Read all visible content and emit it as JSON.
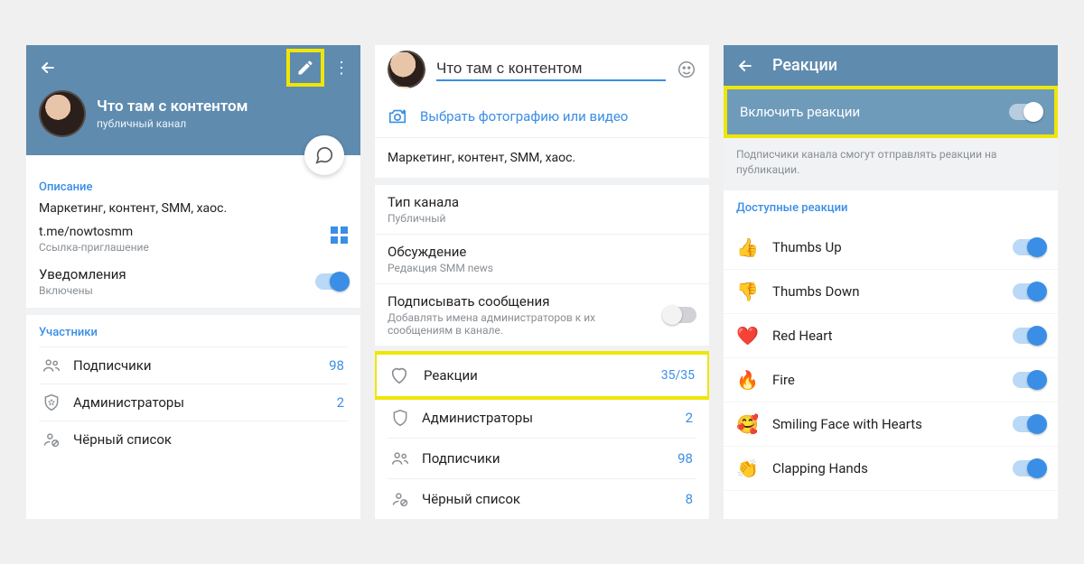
{
  "pane1": {
    "channel_title": "Что там с контентом",
    "channel_subtitle": "публичный канал",
    "section_description_label": "Описание",
    "description": "Маркетинг, контент, SMM, хаос.",
    "invite_link": "t.me/nowtosmm",
    "invite_link_sub": "Ссылка-приглашение",
    "notifications_label": "Уведомления",
    "notifications_value": "Включены",
    "members_label": "Участники",
    "rows": {
      "subscribers": {
        "label": "Подписчики",
        "value": "98"
      },
      "admins": {
        "label": "Администраторы",
        "value": "2"
      },
      "blacklist": {
        "label": "Чёрный список"
      }
    }
  },
  "pane2": {
    "input_value": "Что там с контентом",
    "photo_action": "Выбрать фотографию или видео",
    "description": "Маркетинг, контент, SMM, хаос.",
    "channel_type": {
      "title": "Тип канала",
      "value": "Публичный"
    },
    "discussion": {
      "title": "Обсуждение",
      "value": "Редакция SMM news"
    },
    "sign": {
      "title": "Подписывать сообщения",
      "sub": "Добавлять имена администраторов к их сообщениям в канале."
    },
    "reactions": {
      "label": "Реакции",
      "value": "35/35"
    },
    "admins": {
      "label": "Администраторы",
      "value": "2"
    },
    "subscribers": {
      "label": "Подписчики",
      "value": "98"
    },
    "blacklist": {
      "label": "Чёрный список",
      "value": "8"
    }
  },
  "pane3": {
    "header": "Реакции",
    "enable_label": "Включить реакции",
    "helper": "Подписчики канала смогут отправлять реакции на публикации.",
    "available_label": "Доступные реакции",
    "reactions": [
      {
        "emoji": "👍",
        "name": "Thumbs Up"
      },
      {
        "emoji": "👎",
        "name": "Thumbs Down"
      },
      {
        "emoji": "❤️",
        "name": "Red Heart"
      },
      {
        "emoji": "🔥",
        "name": "Fire"
      },
      {
        "emoji": "🥰",
        "name": "Smiling Face with Hearts"
      },
      {
        "emoji": "👏",
        "name": "Clapping Hands"
      }
    ]
  }
}
